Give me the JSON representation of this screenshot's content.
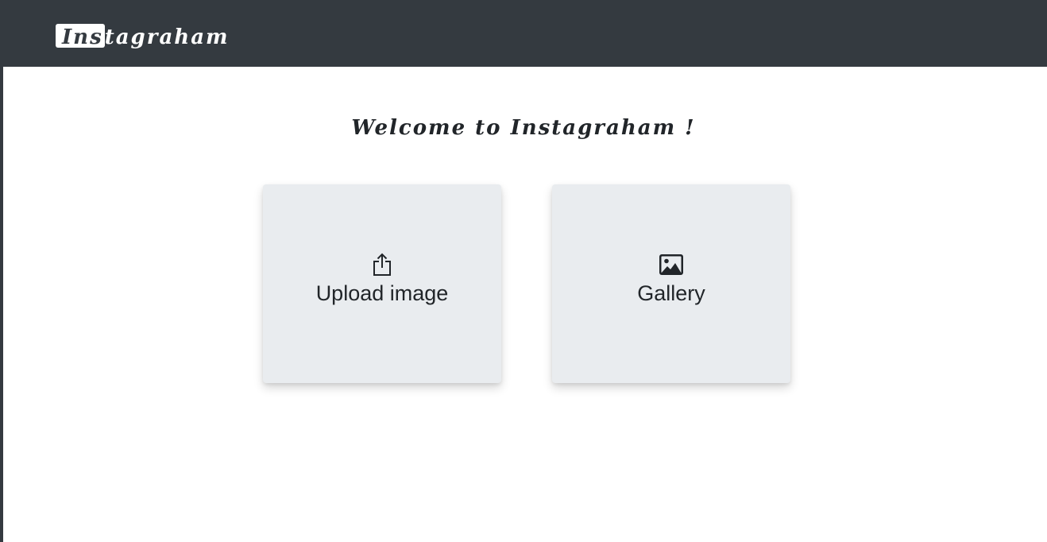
{
  "navbar": {
    "brand_highlight": "Ins",
    "brand_rest": "tagraham"
  },
  "main": {
    "welcome": "Welcome to Instagraham !",
    "cards": [
      {
        "label": "Upload image",
        "icon": "upload-icon"
      },
      {
        "label": "Gallery",
        "icon": "image-icon"
      }
    ]
  },
  "colors": {
    "navbar_bg": "#343a40",
    "card_bg": "#e9ecef",
    "text": "#212529"
  }
}
